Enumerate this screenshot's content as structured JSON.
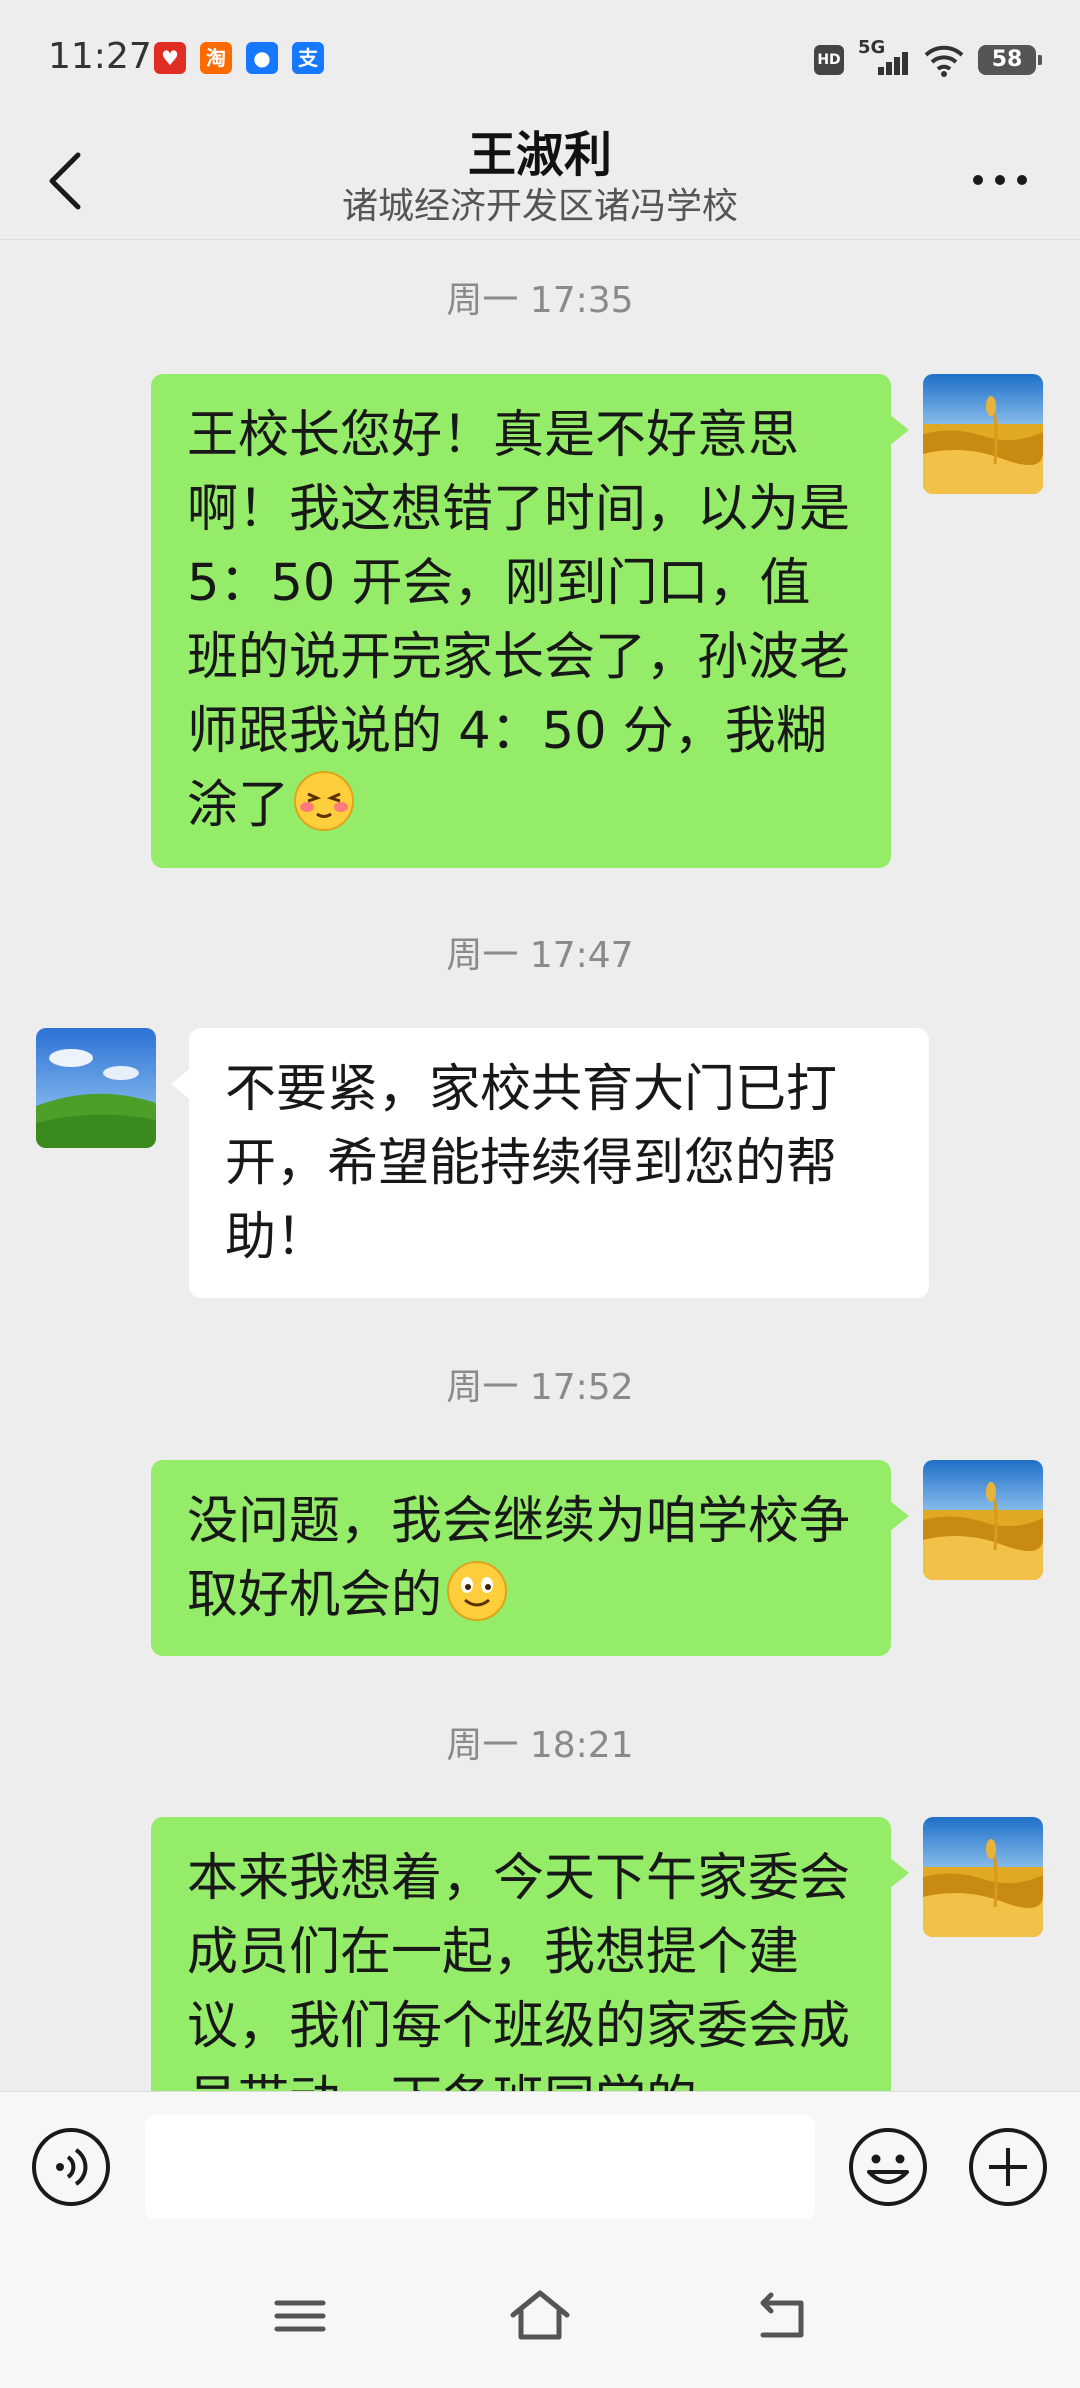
{
  "status_bar": {
    "time": "11:27",
    "apps": [
      {
        "icon": "pinduoduo-icon",
        "glyph": "♥",
        "color": "#e02e24"
      },
      {
        "icon": "taobao-icon",
        "glyph": "淘",
        "color": "#ff6a00"
      },
      {
        "icon": "assistant-icon",
        "glyph": "●",
        "color": "#1677ff"
      },
      {
        "icon": "alipay-icon",
        "glyph": "支",
        "color": "#1677ff"
      }
    ],
    "hd": "HD",
    "network": "5G",
    "battery": "58"
  },
  "header": {
    "title": "王淑利",
    "subtitle": "诸城经济开发区诸冯学校"
  },
  "messages": [
    {
      "timestamp": "周一 17:35",
      "sender": "me",
      "text": "王校长您好！真是不好意思啊！我这想错了时间，以为是 5：50 开会，刚到门口，值班的说开完家长会了，孙波老师跟我说的 4：50 分，我糊涂了",
      "emoji": "embarrassed-emoji-icon"
    },
    {
      "timestamp": "周一 17:47",
      "sender": "them",
      "text": "不要紧，家校共育大门已打开，希望能持续得到您的帮助！"
    },
    {
      "timestamp": "周一 17:52",
      "sender": "me",
      "text": "没问题，我会继续为咱学校争取好机会的",
      "emoji": "smile-emoji-icon"
    },
    {
      "timestamp": "周一 18:21",
      "sender": "me",
      "text": "本来我想着，今天下午家委会成员们在一起，我想提个建议，我们每个班级的家委会成员带动，下各班同学的"
    }
  ],
  "input": {
    "placeholder": ""
  },
  "colors": {
    "background": "#ededed",
    "my_bubble": "#95ec69",
    "their_bubble": "#ffffff"
  }
}
